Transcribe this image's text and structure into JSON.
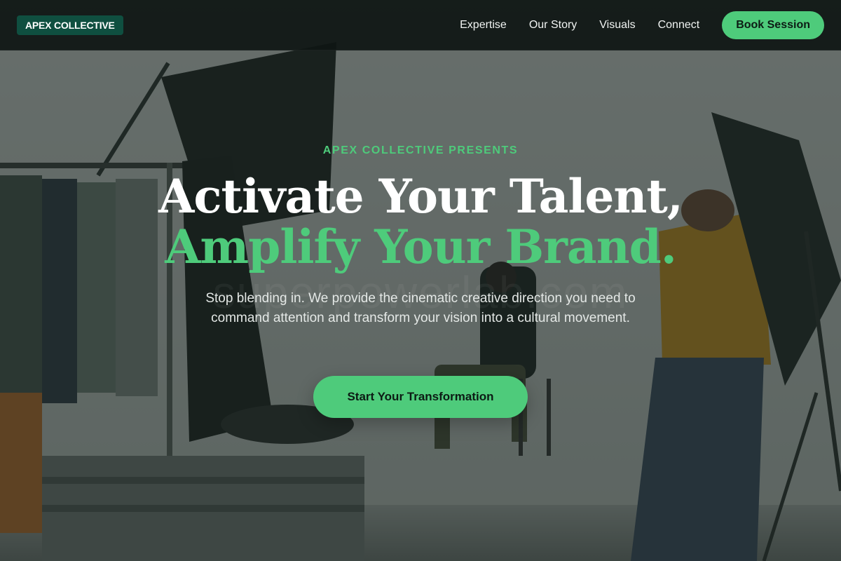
{
  "brand": {
    "logo_text": "APEX COLLECTIVE",
    "logo_bg": "#0f4f40",
    "accent": "#4ecb7b"
  },
  "nav": {
    "links": [
      "Expertise",
      "Our Story",
      "Visuals",
      "Connect"
    ],
    "cta_label": "Book Session"
  },
  "hero": {
    "eyebrow": "APEX COLLECTIVE PRESENTS",
    "headline_line1": "Activate Your Talent,",
    "headline_line2": "Amplify Your Brand.",
    "subtitle": "Stop blending in. We provide the cinematic creative direction you need to command attention and transform your vision into a cultural movement.",
    "cta_label": "Start Your Transformation",
    "watermark": "superpowerlab.com"
  }
}
